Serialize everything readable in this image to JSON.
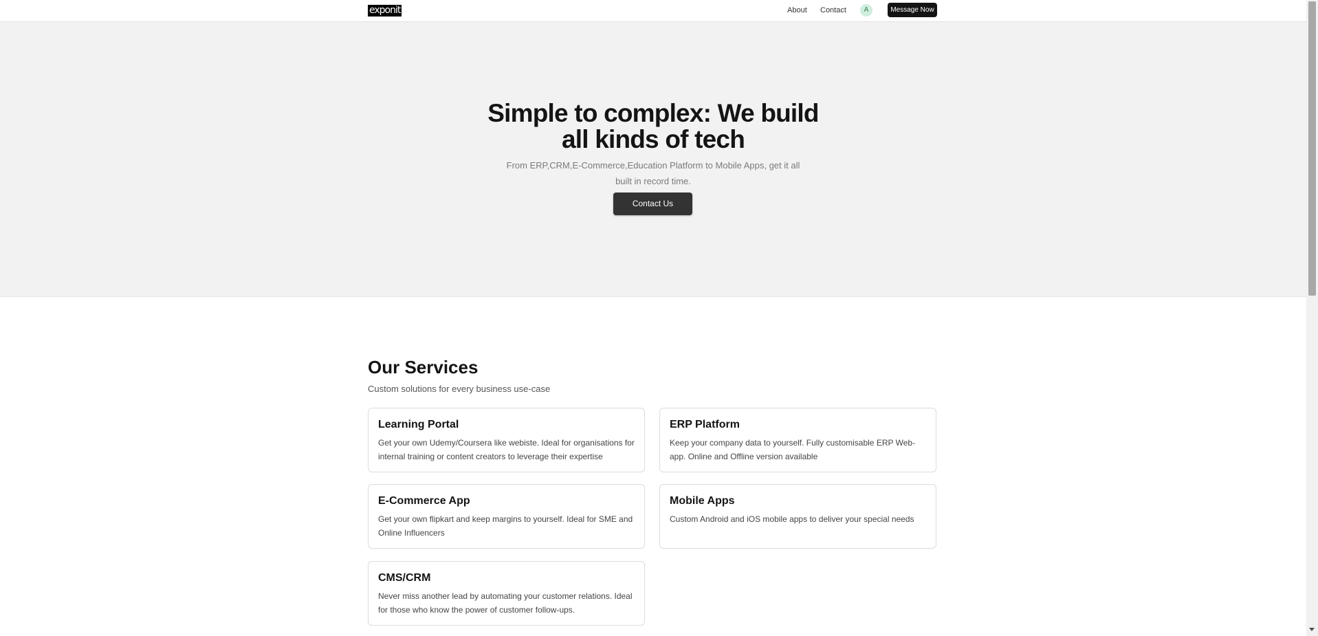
{
  "header": {
    "logo": "exponit",
    "nav": {
      "about": "About",
      "contact": "Contact"
    },
    "avatar_initial": "A",
    "message_button": "Message Now"
  },
  "hero": {
    "title": "Simple to complex: We build all kinds of tech",
    "subtitle": "From ERP,CRM,E-Commerce,Education Platform to Mobile Apps, get it all built in record time.",
    "cta": "Contact Us"
  },
  "services": {
    "title": "Our Services",
    "subtitle": "Custom solutions for every business use-case",
    "items": [
      {
        "title": "Learning Portal",
        "description": "Get your own Udemy/Coursera like webiste. Ideal for organisations for internal training or content creators to leverage their expertise"
      },
      {
        "title": "ERP Platform",
        "description": "Keep your company data to yourself. Fully customisable ERP Web-app. Online and Offline version available"
      },
      {
        "title": "E-Commerce App",
        "description": "Get your own flipkart and keep margins to yourself. Ideal for SME and Online Influencers"
      },
      {
        "title": "Mobile Apps",
        "description": "Custom Android and iOS mobile apps to deliver your special needs"
      },
      {
        "title": "CMS/CRM",
        "description": "Never miss another lead by automating your customer relations. Ideal for those who know the power of customer follow-ups."
      }
    ]
  },
  "colors": {
    "hero_background": "#f2f2f2",
    "primary_button": "#333333",
    "header_button": "#141414",
    "avatar_background": "#cfeedd"
  }
}
